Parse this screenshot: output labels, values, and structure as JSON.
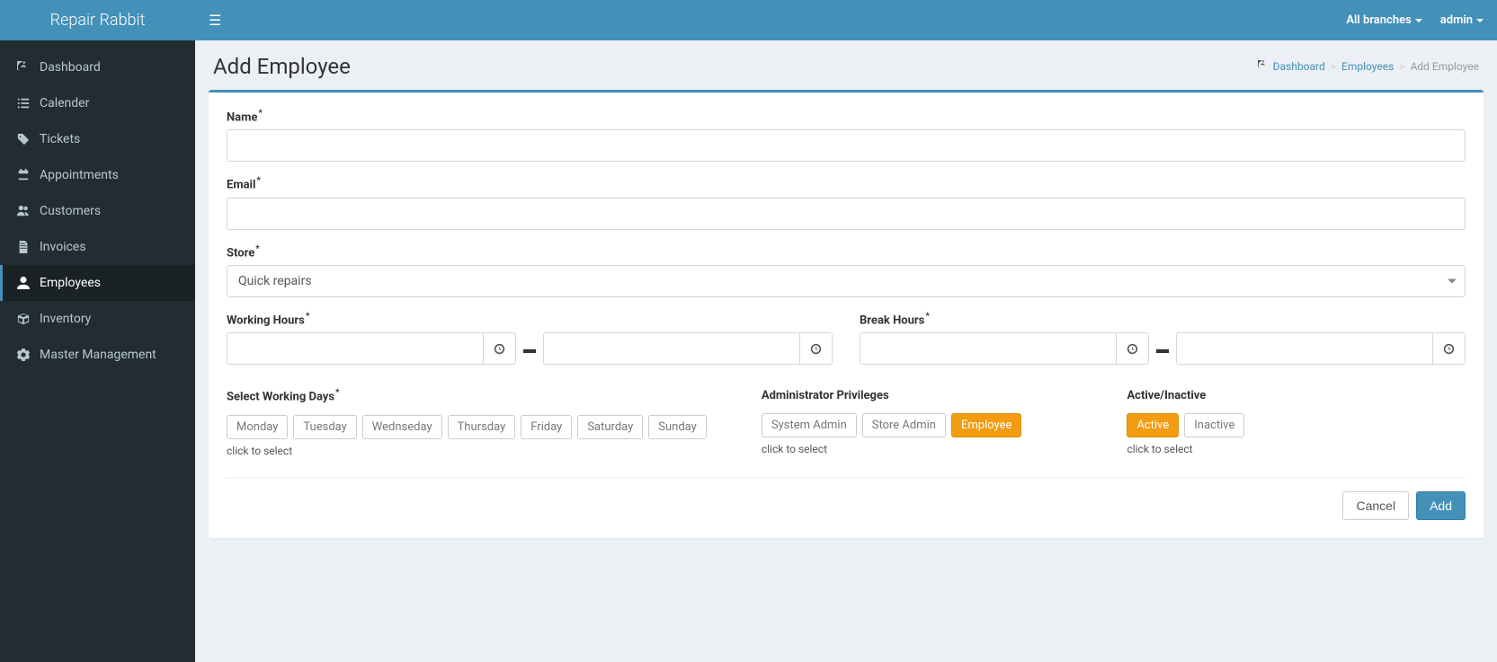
{
  "brand": "Repair Rabbit",
  "topbar": {
    "branches_label": "All branches",
    "user_label": "admin"
  },
  "sidebar": {
    "items": [
      {
        "label": "Dashboard",
        "icon": "dashboard"
      },
      {
        "label": "Calender",
        "icon": "list"
      },
      {
        "label": "Tickets",
        "icon": "tag"
      },
      {
        "label": "Appointments",
        "icon": "calendar"
      },
      {
        "label": "Customers",
        "icon": "users"
      },
      {
        "label": "Invoices",
        "icon": "file"
      },
      {
        "label": "Employees",
        "icon": "user",
        "active": true
      },
      {
        "label": "Inventory",
        "icon": "box"
      },
      {
        "label": "Master Management",
        "icon": "gears"
      }
    ]
  },
  "page": {
    "title": "Add Employee"
  },
  "breadcrumb": {
    "dashboard": "Dashboard",
    "employees": "Employees",
    "current": "Add Employee"
  },
  "form": {
    "name_label": "Name",
    "name_value": "",
    "email_label": "Email",
    "email_value": "",
    "store_label": "Store",
    "store_value": "Quick repairs",
    "working_hours_label": "Working Hours",
    "working_start": "",
    "working_end": "",
    "break_hours_label": "Break Hours",
    "break_start": "",
    "break_end": "",
    "days_label": "Select Working Days",
    "days": [
      "Monday",
      "Tuesday",
      "Wednseday",
      "Thursday",
      "Friday",
      "Saturday",
      "Sunday"
    ],
    "priv_label": "Administrator Privileges",
    "privs": [
      {
        "label": "System Admin",
        "selected": false
      },
      {
        "label": "Store Admin",
        "selected": false
      },
      {
        "label": "Employee",
        "selected": true
      }
    ],
    "status_label": "Active/Inactive",
    "status": [
      {
        "label": "Active",
        "selected": true
      },
      {
        "label": "Inactive",
        "selected": false
      }
    ],
    "hint": "click to select",
    "cancel_label": "Cancel",
    "add_label": "Add"
  }
}
